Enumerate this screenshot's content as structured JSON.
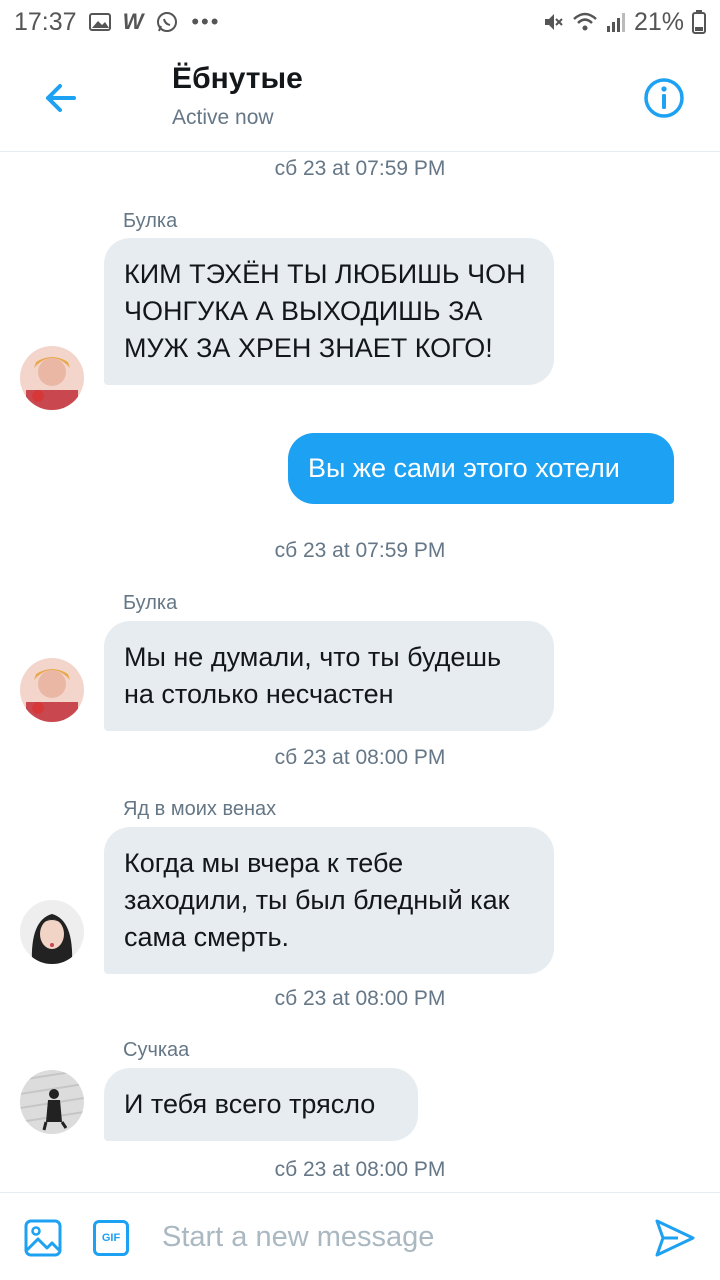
{
  "status_bar": {
    "time": "17:37",
    "battery": "21%"
  },
  "header": {
    "title": "Ёбнутые",
    "subtitle": "Active now"
  },
  "messages": [
    {
      "timestamp": "сб 23 at 07:59 PM"
    },
    {
      "sender": "Булка",
      "text": "КИМ ТЭХЁН ТЫ ЛЮБИШЬ ЧОН ЧОНГУКА А ВЫХОДИШЬ ЗА МУЖ ЗА ХРЕН ЗНАЕТ КОГО!"
    },
    {
      "outgoing_text": "Вы же сами этого хотели"
    },
    {
      "timestamp": "сб 23 at 07:59 PM"
    },
    {
      "sender": "Булка",
      "text": "Мы не думали, что ты будешь на столько несчастен"
    },
    {
      "timestamp": "сб 23 at 08:00 PM"
    },
    {
      "sender": "Яд в моих венах",
      "text": "Когда мы вчера к тебе заходили, ты был бледный как сама смерть."
    },
    {
      "timestamp": "сб 23 at 08:00 PM"
    },
    {
      "sender": "Сучкаа",
      "text": "И тебя всего трясло"
    },
    {
      "timestamp": "сб 23 at 08:00 PM"
    }
  ],
  "composer": {
    "placeholder": "Start a new message",
    "gif_label": "GIF"
  },
  "colors": {
    "accent": "#1da1f2",
    "incoming_bubble": "#e6ecf0",
    "muted": "#657786"
  },
  "icons": [
    "back-arrow-icon",
    "info-icon",
    "image-icon",
    "gif-icon",
    "send-icon"
  ]
}
